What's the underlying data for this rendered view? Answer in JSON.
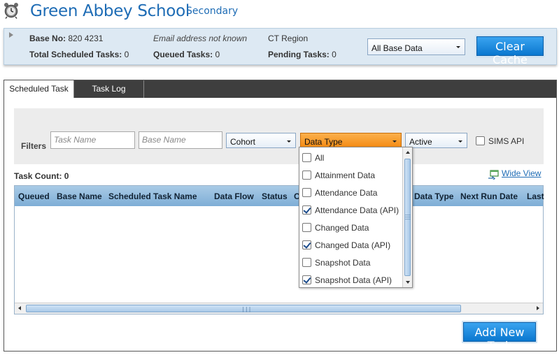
{
  "header": {
    "school_name": "Green Abbey School",
    "school_type": "Secondary"
  },
  "info": {
    "base_no_label": "Base No:",
    "base_no_value": "820 4231",
    "email_text": "Email address not known",
    "region": "CT Region",
    "total_label": "Total Scheduled Tasks:",
    "total_value": "0",
    "queued_label": "Queued Tasks:",
    "queued_value": "0",
    "pending_label": "Pending Tasks:",
    "pending_value": "0",
    "base_data_select": "All Base Data",
    "clear_cache": "Clear Cache"
  },
  "tabs": [
    {
      "label": "Scheduled Task",
      "active": true
    },
    {
      "label": "Task Log",
      "active": false
    }
  ],
  "filters": {
    "label": "Filters",
    "task_name_placeholder": "Task Name",
    "base_name_placeholder": "Base Name",
    "cohort": "Cohort",
    "data_type": "Data Type",
    "active": "Active",
    "sims_api": "SIMS API"
  },
  "task_count": "Task Count: 0",
  "wide_view": "Wide View",
  "grid": {
    "columns": [
      "Queued",
      "Base Name",
      "Scheduled Task Name",
      "Data Flow",
      "Status",
      "O",
      "Data Type",
      "Next Run Date",
      "Last"
    ]
  },
  "data_type_options": [
    {
      "label": "All",
      "checked": false
    },
    {
      "label": "Attainment Data",
      "checked": false
    },
    {
      "label": "Attendance Data",
      "checked": false
    },
    {
      "label": "Attendance Data (API)",
      "checked": true
    },
    {
      "label": "Changed Data",
      "checked": false
    },
    {
      "label": "Changed Data (API)",
      "checked": true
    },
    {
      "label": "Snapshot Data",
      "checked": false
    },
    {
      "label": "Snapshot Data (API)",
      "checked": true
    }
  ],
  "add_new_task": "Add New Task",
  "colors": {
    "accent": "#1e6cb5",
    "data_type_highlight": "#f7941d",
    "grid_header": "#8fbade"
  }
}
